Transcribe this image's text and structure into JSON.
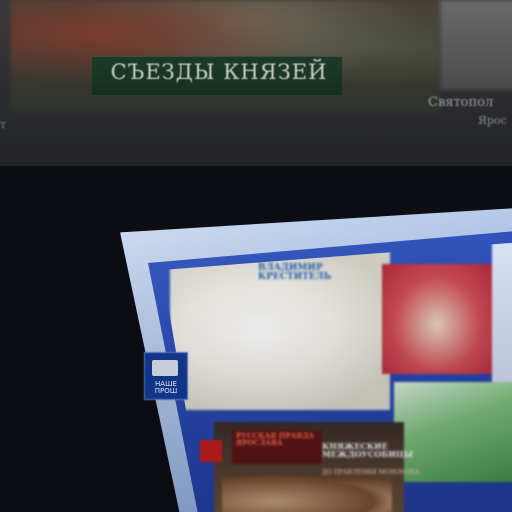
{
  "wall": {
    "caption": "СЪЕЗДЫ КНЯЗЕЙ",
    "right_caption": "Святопол",
    "right_sub": "Ярос",
    "left_fragment": "т"
  },
  "kiosk": {
    "side_label": "НАШЕ ПРОШ",
    "top_tile_title": "ВЛАДИМИР КРЕСТИТЕЛЬ",
    "bottom_tile_title1": "РУССКАЯ ПРАВДА ЯРОСЛАВА",
    "bottom_tile_title2": "КНЯЖЕСКИЕ МЕЖДОУСОБИЦЫ",
    "bottom_tile_title3": "ДО ПРАВЛЕНИЯ МОНОМАХА"
  },
  "colors": {
    "screen_blue": "#2a49b3",
    "caption_green": "#1d3a29",
    "accent_red": "#c21d1d"
  }
}
